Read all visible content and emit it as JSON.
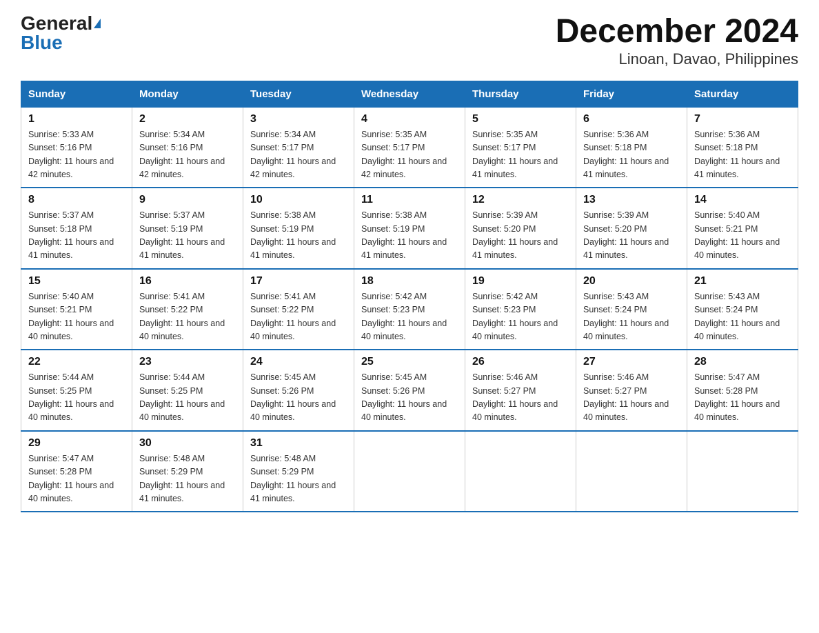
{
  "header": {
    "logo_general": "General",
    "logo_blue": "Blue",
    "title": "December 2024",
    "subtitle": "Linoan, Davao, Philippines"
  },
  "weekdays": [
    "Sunday",
    "Monday",
    "Tuesday",
    "Wednesday",
    "Thursday",
    "Friday",
    "Saturday"
  ],
  "weeks": [
    [
      {
        "day": "1",
        "sunrise": "5:33 AM",
        "sunset": "5:16 PM",
        "daylight": "11 hours and 42 minutes."
      },
      {
        "day": "2",
        "sunrise": "5:34 AM",
        "sunset": "5:16 PM",
        "daylight": "11 hours and 42 minutes."
      },
      {
        "day": "3",
        "sunrise": "5:34 AM",
        "sunset": "5:17 PM",
        "daylight": "11 hours and 42 minutes."
      },
      {
        "day": "4",
        "sunrise": "5:35 AM",
        "sunset": "5:17 PM",
        "daylight": "11 hours and 42 minutes."
      },
      {
        "day": "5",
        "sunrise": "5:35 AM",
        "sunset": "5:17 PM",
        "daylight": "11 hours and 41 minutes."
      },
      {
        "day": "6",
        "sunrise": "5:36 AM",
        "sunset": "5:18 PM",
        "daylight": "11 hours and 41 minutes."
      },
      {
        "day": "7",
        "sunrise": "5:36 AM",
        "sunset": "5:18 PM",
        "daylight": "11 hours and 41 minutes."
      }
    ],
    [
      {
        "day": "8",
        "sunrise": "5:37 AM",
        "sunset": "5:18 PM",
        "daylight": "11 hours and 41 minutes."
      },
      {
        "day": "9",
        "sunrise": "5:37 AM",
        "sunset": "5:19 PM",
        "daylight": "11 hours and 41 minutes."
      },
      {
        "day": "10",
        "sunrise": "5:38 AM",
        "sunset": "5:19 PM",
        "daylight": "11 hours and 41 minutes."
      },
      {
        "day": "11",
        "sunrise": "5:38 AM",
        "sunset": "5:19 PM",
        "daylight": "11 hours and 41 minutes."
      },
      {
        "day": "12",
        "sunrise": "5:39 AM",
        "sunset": "5:20 PM",
        "daylight": "11 hours and 41 minutes."
      },
      {
        "day": "13",
        "sunrise": "5:39 AM",
        "sunset": "5:20 PM",
        "daylight": "11 hours and 41 minutes."
      },
      {
        "day": "14",
        "sunrise": "5:40 AM",
        "sunset": "5:21 PM",
        "daylight": "11 hours and 40 minutes."
      }
    ],
    [
      {
        "day": "15",
        "sunrise": "5:40 AM",
        "sunset": "5:21 PM",
        "daylight": "11 hours and 40 minutes."
      },
      {
        "day": "16",
        "sunrise": "5:41 AM",
        "sunset": "5:22 PM",
        "daylight": "11 hours and 40 minutes."
      },
      {
        "day": "17",
        "sunrise": "5:41 AM",
        "sunset": "5:22 PM",
        "daylight": "11 hours and 40 minutes."
      },
      {
        "day": "18",
        "sunrise": "5:42 AM",
        "sunset": "5:23 PM",
        "daylight": "11 hours and 40 minutes."
      },
      {
        "day": "19",
        "sunrise": "5:42 AM",
        "sunset": "5:23 PM",
        "daylight": "11 hours and 40 minutes."
      },
      {
        "day": "20",
        "sunrise": "5:43 AM",
        "sunset": "5:24 PM",
        "daylight": "11 hours and 40 minutes."
      },
      {
        "day": "21",
        "sunrise": "5:43 AM",
        "sunset": "5:24 PM",
        "daylight": "11 hours and 40 minutes."
      }
    ],
    [
      {
        "day": "22",
        "sunrise": "5:44 AM",
        "sunset": "5:25 PM",
        "daylight": "11 hours and 40 minutes."
      },
      {
        "day": "23",
        "sunrise": "5:44 AM",
        "sunset": "5:25 PM",
        "daylight": "11 hours and 40 minutes."
      },
      {
        "day": "24",
        "sunrise": "5:45 AM",
        "sunset": "5:26 PM",
        "daylight": "11 hours and 40 minutes."
      },
      {
        "day": "25",
        "sunrise": "5:45 AM",
        "sunset": "5:26 PM",
        "daylight": "11 hours and 40 minutes."
      },
      {
        "day": "26",
        "sunrise": "5:46 AM",
        "sunset": "5:27 PM",
        "daylight": "11 hours and 40 minutes."
      },
      {
        "day": "27",
        "sunrise": "5:46 AM",
        "sunset": "5:27 PM",
        "daylight": "11 hours and 40 minutes."
      },
      {
        "day": "28",
        "sunrise": "5:47 AM",
        "sunset": "5:28 PM",
        "daylight": "11 hours and 40 minutes."
      }
    ],
    [
      {
        "day": "29",
        "sunrise": "5:47 AM",
        "sunset": "5:28 PM",
        "daylight": "11 hours and 40 minutes."
      },
      {
        "day": "30",
        "sunrise": "5:48 AM",
        "sunset": "5:29 PM",
        "daylight": "11 hours and 41 minutes."
      },
      {
        "day": "31",
        "sunrise": "5:48 AM",
        "sunset": "5:29 PM",
        "daylight": "11 hours and 41 minutes."
      },
      null,
      null,
      null,
      null
    ]
  ]
}
